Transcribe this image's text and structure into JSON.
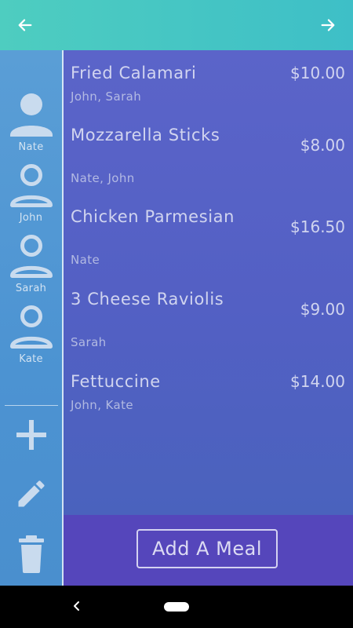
{
  "header": {
    "back_icon": "arrow-left-icon",
    "forward_icon": "arrow-right-icon",
    "color": "#4ecdc0"
  },
  "sidebar": {
    "people": [
      {
        "name": "Nate",
        "icon": "person-filled-icon",
        "selected": true
      },
      {
        "name": "John",
        "icon": "person-outline-icon",
        "selected": false
      },
      {
        "name": "Sarah",
        "icon": "person-outline-icon",
        "selected": false
      },
      {
        "name": "Kate",
        "icon": "person-outline-icon",
        "selected": false
      }
    ],
    "actions": [
      {
        "icon": "plus-icon"
      },
      {
        "icon": "pencil-icon"
      },
      {
        "icon": "trash-icon"
      }
    ]
  },
  "meals": [
    {
      "name": "Fried Calamari",
      "price": "$10.00",
      "people": "John, Sarah"
    },
    {
      "name": "Mozzarella Sticks",
      "price": "$8.00",
      "people": "Nate, John"
    },
    {
      "name": "Chicken Parmesian",
      "price": "$16.50",
      "people": "Nate"
    },
    {
      "name": "3 Cheese Raviolis",
      "price": "$9.00",
      "people": "Sarah"
    },
    {
      "name": "Fettuccine",
      "price": "$14.00",
      "people": "John, Kate"
    }
  ],
  "footer": {
    "add_meal_label": "Add A Meal"
  },
  "system_nav": {
    "back_icon": "system-back-icon",
    "home_icon": "home-pill-icon"
  }
}
